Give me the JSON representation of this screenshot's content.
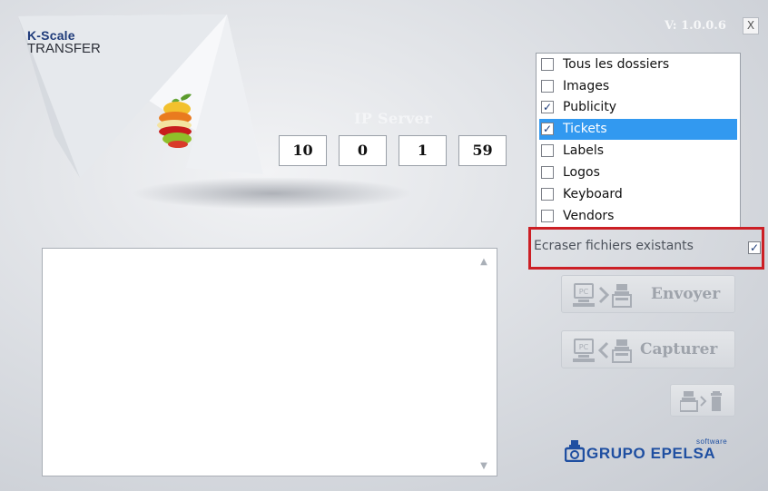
{
  "app": {
    "brand_line1": "K-Scale",
    "brand_line2": "TRANSFER",
    "version": "V: 1.0.0.6",
    "close_label": "X"
  },
  "ip_server": {
    "label": "IP Server",
    "octets": [
      "10",
      "0",
      "1",
      "59"
    ]
  },
  "folders": [
    {
      "label": "Tous les dossiers",
      "checked": false,
      "selected": false
    },
    {
      "label": "Images",
      "checked": false,
      "selected": false
    },
    {
      "label": "Publicity",
      "checked": true,
      "selected": false
    },
    {
      "label": "Tickets",
      "checked": true,
      "selected": true
    },
    {
      "label": "Labels",
      "checked": false,
      "selected": false
    },
    {
      "label": "Logos",
      "checked": false,
      "selected": false
    },
    {
      "label": "Keyboard",
      "checked": false,
      "selected": false
    },
    {
      "label": "Vendors",
      "checked": false,
      "selected": false
    }
  ],
  "overwrite": {
    "label": "Ecraser fichiers existants",
    "checked": true
  },
  "buttons": {
    "send_label": "Envoyer",
    "capture_label": "Capturer"
  },
  "logo": {
    "software": "software",
    "name": "GRUPO EPELSA"
  },
  "icons": {
    "send": "pc-to-scale-icon",
    "capture": "scale-to-pc-icon",
    "delete": "scale-to-trash-icon",
    "fruit": "fruit-stack-icon",
    "logo": "epelsa-scale-logo-icon"
  },
  "colors": {
    "selection": "#3299f0",
    "highlight_border": "#cc1f25",
    "brand_blue": "#1f4fa1"
  }
}
